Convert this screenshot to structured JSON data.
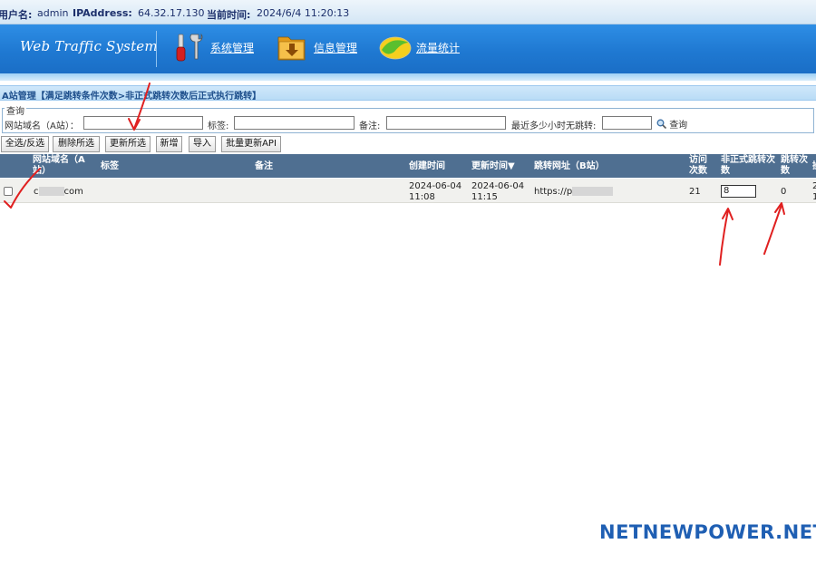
{
  "topbar": {
    "user_label": "用户名:",
    "user_value": "admin",
    "ip_label": "IPAddress:",
    "ip_value": "64.32.17.130",
    "time_label": "当前时间:",
    "time_value": "2024/6/4 11:20:13"
  },
  "header": {
    "logo": "Web Traffic System",
    "nav": [
      {
        "label": "系统管理",
        "icon": "tools-icon"
      },
      {
        "label": "信息管理",
        "icon": "folder-download-icon"
      },
      {
        "label": "流量统计",
        "icon": "chart-disc-icon"
      }
    ]
  },
  "section": {
    "title": "A站管理【满足跳转条件次数>非正式跳转次数后正式执行跳转】"
  },
  "query": {
    "legend": "查询",
    "domain_label": "网站域名（A站）：",
    "domain_value": "",
    "tag_label": "标签:",
    "tag_value": "",
    "remark_label": "备注:",
    "remark_value": "",
    "hours_label": "最近多少小时无跳转:",
    "hours_value": "",
    "search_label": "查询"
  },
  "toolbar": {
    "select_all": "全选/反选",
    "delete_selected": "删除所选",
    "update_selected": "更新所选",
    "add": "新增",
    "import": "导入",
    "batch_update_api": "批量更新API"
  },
  "table": {
    "headers": {
      "domain": "网站域名（A站）",
      "tag": "标签",
      "remark": "备注",
      "created": "创建时间",
      "updated": "更新时间▼",
      "redirect_url": "跳转网址（B站）",
      "visits": "访问次数",
      "unofficial_jumps": "非正式跳转次数",
      "jumps": "跳转次数",
      "more": "操"
    },
    "rows": [
      {
        "domain_prefix": "c",
        "domain_suffix": "com",
        "tag": "",
        "remark": "",
        "created_date": "2024-06-04",
        "created_time": "11:08",
        "updated_date": "2024-06-04",
        "updated_time": "11:15",
        "redirect_prefix": "https://p",
        "visits": "21",
        "unofficial_jumps": "8",
        "jumps": "0",
        "extra_1": "2",
        "extra_2": "1"
      }
    ]
  },
  "watermark": "NETNEWPOWER.NET",
  "colors": {
    "banner": "#1f79d2",
    "table_header": "#4f6f91",
    "annotation": "#e02020",
    "watermark": "#1f5fb3"
  }
}
